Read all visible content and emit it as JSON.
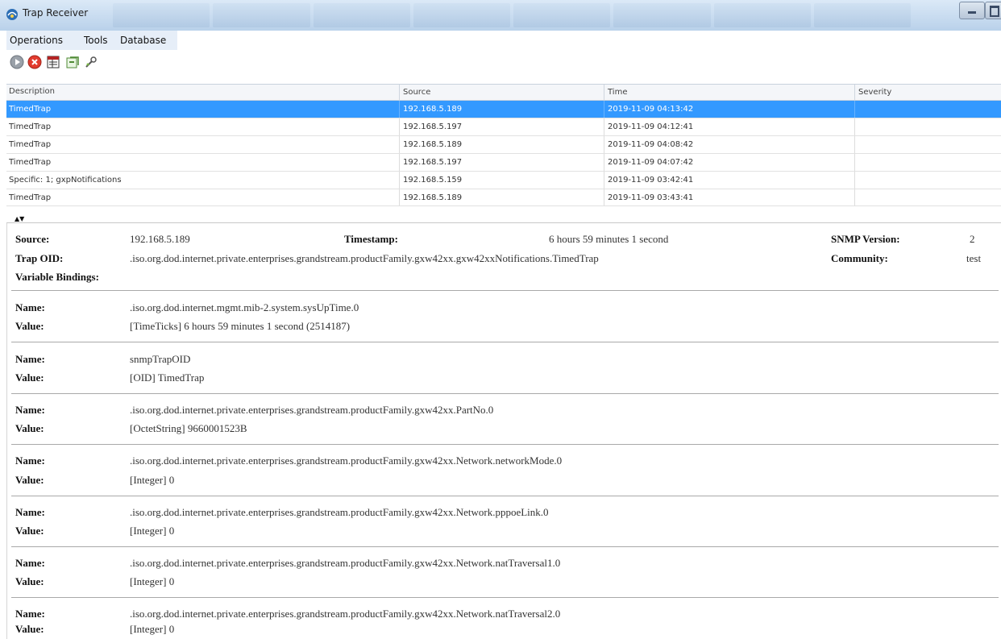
{
  "window": {
    "title": "Trap Receiver"
  },
  "menu": {
    "items": [
      "Operations",
      "Tools",
      "Database"
    ]
  },
  "toolbar": {
    "icons": [
      "start-icon",
      "stop-icon",
      "filter-icon",
      "export-icon",
      "tool-icon"
    ]
  },
  "table": {
    "columns": [
      "Description",
      "Source",
      "Time",
      "Severity"
    ],
    "rows": [
      {
        "description": "TimedTrap",
        "source": "192.168.5.189",
        "time": "2019-11-09 04:13:42",
        "severity": ""
      },
      {
        "description": "TimedTrap",
        "source": "192.168.5.197",
        "time": "2019-11-09 04:12:41",
        "severity": ""
      },
      {
        "description": "TimedTrap",
        "source": "192.168.5.189",
        "time": "2019-11-09 04:08:42",
        "severity": ""
      },
      {
        "description": "TimedTrap",
        "source": "192.168.5.197",
        "time": "2019-11-09 04:07:42",
        "severity": ""
      },
      {
        "description": "Specific: 1; gxpNotifications",
        "source": "192.168.5.159",
        "time": "2019-11-09 03:42:41",
        "severity": ""
      },
      {
        "description": "TimedTrap",
        "source": "192.168.5.189",
        "time": "2019-11-09 03:43:41",
        "severity": ""
      }
    ],
    "selected_row": 0
  },
  "details": {
    "source_label": "Source:",
    "source_value": "192.168.5.189",
    "timestamp_label": "Timestamp:",
    "timestamp_value": "6 hours 59 minutes 1 second",
    "snmp_version_label": "SNMP Version:",
    "snmp_version_value": "2",
    "trap_oid_label": "Trap OID:",
    "trap_oid_value": ".iso.org.dod.internet.private.enterprises.grandstream.productFamily.gxw42xx.gxw42xxNotifications.TimedTrap",
    "community_label": "Community:",
    "community_value": "test",
    "variable_bindings_label": "Variable Bindings:",
    "name_label": "Name:",
    "value_label": "Value:",
    "bindings": [
      {
        "name": ".iso.org.dod.internet.mgmt.mib-2.system.sysUpTime.0",
        "value": "[TimeTicks] 6 hours 59 minutes 1 second (2514187)"
      },
      {
        "name": "snmpTrapOID",
        "value": "[OID] TimedTrap"
      },
      {
        "name": ".iso.org.dod.internet.private.enterprises.grandstream.productFamily.gxw42xx.PartNo.0",
        "value": "[OctetString] 9660001523B"
      },
      {
        "name": ".iso.org.dod.internet.private.enterprises.grandstream.productFamily.gxw42xx.Network.networkMode.0",
        "value": "[Integer] 0"
      },
      {
        "name": ".iso.org.dod.internet.private.enterprises.grandstream.productFamily.gxw42xx.Network.pppoeLink.0",
        "value": "[Integer] 0"
      },
      {
        "name": ".iso.org.dod.internet.private.enterprises.grandstream.productFamily.gxw42xx.Network.natTraversal1.0",
        "value": "[Integer] 0"
      },
      {
        "name": ".iso.org.dod.internet.private.enterprises.grandstream.productFamily.gxw42xx.Network.natTraversal2.0",
        "value": "[Integer] 0"
      }
    ]
  },
  "colors": {
    "selection": "#3399ff",
    "titlebar": "#c8dcf0",
    "menu_strip": "#e6eef8"
  }
}
